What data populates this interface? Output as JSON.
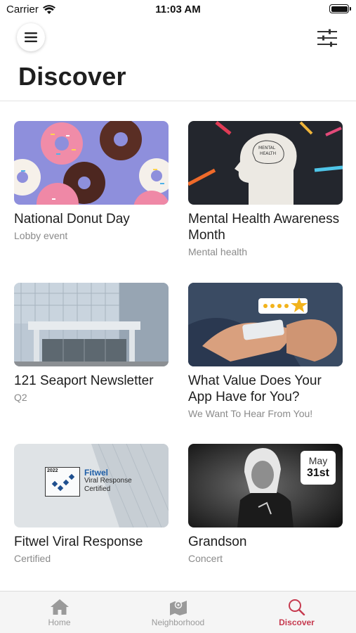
{
  "status_bar": {
    "carrier": "Carrier",
    "time": "11:03 AM"
  },
  "header": {
    "title": "Discover"
  },
  "cards": [
    {
      "title": "National Donut Day",
      "subtitle": "Lobby event"
    },
    {
      "title": "Mental Health Awareness Month",
      "subtitle": "Mental health",
      "image_text": "MENTAL HEALTH"
    },
    {
      "title": "121 Seaport Newsletter",
      "subtitle": "Q2"
    },
    {
      "title": "What Value Does Your App Have for You?",
      "subtitle": "We Want To Hear From You!"
    },
    {
      "title": "Fitwel Viral Response",
      "subtitle": "Certified",
      "image_logo": {
        "year": "2022",
        "brand": "Fitwel",
        "line1": "Viral Response",
        "line2": "Certified"
      }
    },
    {
      "title": "Grandson",
      "subtitle": "Concert",
      "badge": {
        "month": "May",
        "day": "31st"
      }
    }
  ],
  "tab_bar": {
    "items": [
      {
        "label": "Home",
        "icon": "home-icon"
      },
      {
        "label": "Neighborhood",
        "icon": "map-icon"
      },
      {
        "label": "Discover",
        "icon": "search-icon"
      }
    ],
    "active": "Discover",
    "active_color": "#c63a4f"
  }
}
